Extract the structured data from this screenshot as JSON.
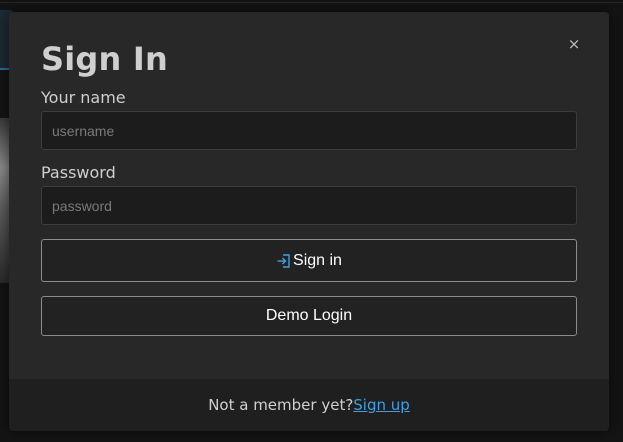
{
  "modal": {
    "title": "Sign In",
    "close_label": "×",
    "name_label": "Your name",
    "name_placeholder": "username",
    "name_value": "",
    "password_label": "Password",
    "password_placeholder": "password",
    "password_value": "",
    "signin_label": "Sign in",
    "signin_icon": "sign-in-icon",
    "demo_label": "Demo Login"
  },
  "footer": {
    "prompt": "Not a member yet?",
    "signup_link": "Sign up"
  },
  "colors": {
    "modal_bg": "#282828",
    "footer_bg": "#1f1f1f",
    "link": "#3fa0e0",
    "icon_accent": "#3fa0e0"
  }
}
